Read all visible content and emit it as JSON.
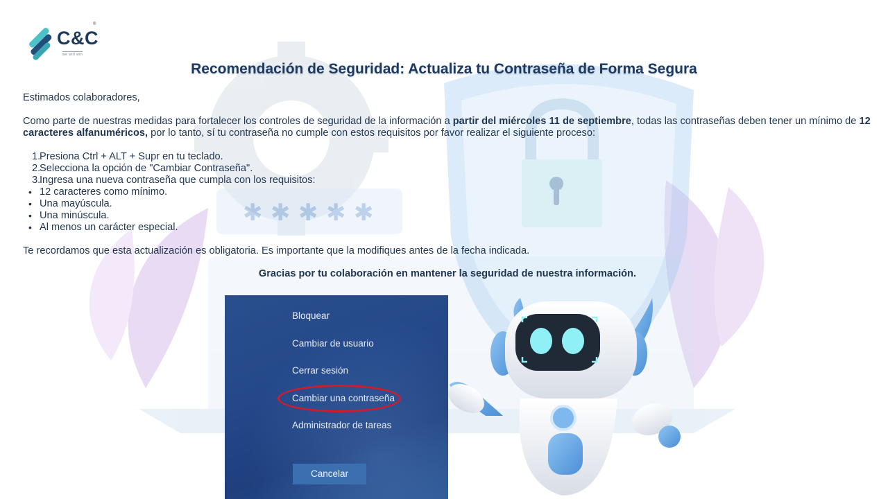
{
  "brand": {
    "logo_text": "C&C",
    "logo_tagline": "we will win",
    "registered_mark": "®"
  },
  "header": {
    "title": "Recomendación de Seguridad: Actualiza tu Contraseña de Forma Segura"
  },
  "body": {
    "greeting": "Estimados colaboradores,",
    "intro_1": "Como parte de nuestras medidas para fortalecer los controles de seguridad de la información a ",
    "intro_bold_1": "partir del miércoles 11 de septiembre",
    "intro_2": ", todas las contraseñas deben tener un mínimo de ",
    "intro_bold_2": "12 caracteres alfanuméricos,",
    "intro_3": " por lo tanto, sí tu contraseña no cumple con estos requisitos por favor realizar el siguiente proceso:",
    "steps": [
      {
        "num": "1.",
        "text": "Presiona Ctrl + ALT + Supr en tu teclado."
      },
      {
        "num": "2.",
        "text": "Selecciona la opción de \"Cambiar Contraseña\"."
      },
      {
        "num": "3.",
        "text": "Ingresa una nueva contraseña que cumpla con los requisitos:"
      }
    ],
    "requirements": [
      "12 caracteres como mínimo.",
      "Una mayúscula.",
      "Una minúscula.",
      "Al menos un carácter especial."
    ],
    "reminder": "Te recordamos que esta actualización es obligatoria. Es importante que la modifiques antes de la fecha indicada.",
    "thanks": "Gracias por tu colaboración en mantener la seguridad de nuestra información."
  },
  "security_screen": {
    "options": [
      "Bloquear",
      "Cambiar de usuario",
      "Cerrar sesión",
      "Cambiar una contraseña",
      "Administrador de tareas"
    ],
    "highlighted_option": "Cambiar una contraseña",
    "cancel_label": "Cancelar",
    "highlight_color": "#d11a2a"
  },
  "illustration": {
    "password_mask": "*****",
    "icons": [
      "shield-icon",
      "padlock-icon",
      "gear-icon",
      "robot-mascot"
    ]
  }
}
